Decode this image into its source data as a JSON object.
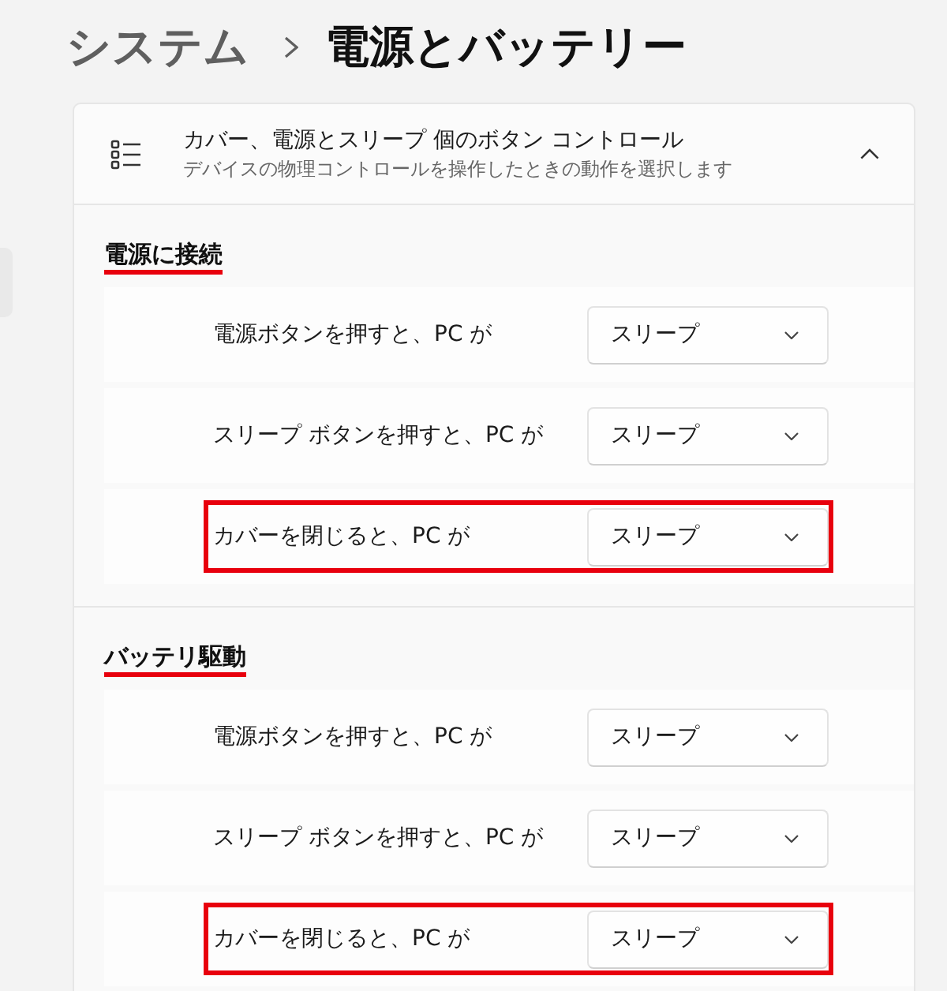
{
  "breadcrumb": {
    "parent": "システム",
    "current": "電源とバッテリー"
  },
  "section": {
    "title": "カバー、電源とスリープ 個のボタン コントロール",
    "subtitle": "デバイスの物理コントロールを操作したときの動作を選択します",
    "expanded": true
  },
  "groups": [
    {
      "heading": "電源に接続",
      "underlined": true,
      "rows": [
        {
          "label": "電源ボタンを押すと、PC が",
          "value": "スリープ",
          "highlighted": false
        },
        {
          "label": "スリープ ボタンを押すと、PC が",
          "value": "スリープ",
          "highlighted": false
        },
        {
          "label": "カバーを閉じると、PC が",
          "value": "スリープ",
          "highlighted": true
        }
      ]
    },
    {
      "heading": "バッテリ駆動",
      "underlined": true,
      "rows": [
        {
          "label": "電源ボタンを押すと、PC が",
          "value": "スリープ",
          "highlighted": false
        },
        {
          "label": "スリープ ボタンを押すと、PC が",
          "value": "スリープ",
          "highlighted": false
        },
        {
          "label": "カバーを閉じると、PC が",
          "value": "スリープ",
          "highlighted": true
        }
      ]
    }
  ]
}
